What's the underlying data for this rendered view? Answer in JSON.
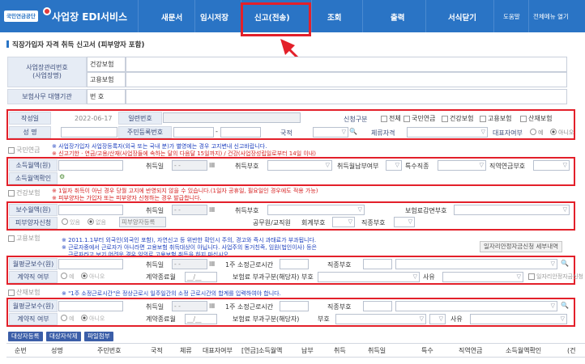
{
  "nav": {
    "logo_text": "국민연금공단",
    "app_title": "사업장 EDI서비스",
    "menu": [
      "새문서",
      "임시저장",
      "신고(전송)",
      "조회",
      "출력",
      "서식닫기"
    ],
    "help": "도움말",
    "full_menu": "전체메뉴 열기"
  },
  "page": {
    "title": "직장가입자 자격 취득 신고서 (피부양자 포함)"
  },
  "header_form": {
    "biz_no_label": "사업장관리번호\n(사업장명)",
    "health": "건강보험",
    "employment": "고용보험",
    "agency_label": "보험사무 대행기관",
    "number_label": "번 호"
  },
  "report": {
    "date_label": "작성일",
    "date_value": "2022-06-17",
    "serial_label": "일련번호",
    "report_type_label": "신청구분",
    "types": [
      "전체",
      "국민연금",
      "건강보험",
      "고용보험",
      "산재보험"
    ],
    "name_label": "성 명",
    "rrn_label": "주민등록번호",
    "nationality_label": "국적",
    "residence_label": "체류자격",
    "rep_label": "대표자여부",
    "yes": "예",
    "no": "아니오"
  },
  "pension": {
    "section": "국민연금",
    "note1": "※ 사업장가입자 사업장등록자(외국 또는 국내 분)가 별영에는 경우 고지변내 신고바랍니다.",
    "note2": "※ 신고기한 · 연금/고용/산재(사업장들에 속하는 달의 다음달 15일까지) / 건강(사업장성립일로부터 14일 이내)",
    "income_label": "소득월액(원)",
    "acq_date_label": "취득일",
    "date_placeholder": "-   -",
    "acq_code_label": "취득부호",
    "acq_month_pay_label": "취득월납부여부",
    "special_label": "특수직종",
    "occ_pension_label": "직역연금부호",
    "income_confirm_label": "소득월액확인"
  },
  "health": {
    "section": "건강보험",
    "note1": "※ 1일자 취득이 아닌 경우 당월 고지에 반영되지 않을 수 있습니다.(1일자 공휴일, 필요일인 경우에도 적용 가능)",
    "note2": "※ 피부양자는 가입자 또는 피부양자 신청하는 경우 발급합니다.",
    "pay_label": "보수월액(원)",
    "acq_date_label": "취득일",
    "acq_code_label": "취득부호",
    "reduce_label": "보험료감면부호",
    "dependent_label": "피부양자신청",
    "has": "있음",
    "none": "없음",
    "dependent_reg": "피부양자등록",
    "civil_label": "공무원/교직원",
    "account_label": "회계부호",
    "job_label": "직종부호"
  },
  "employment": {
    "section": "고용보험",
    "note1": "※ 2011.1.1부터 외국인(외국인 포함), 자연신고 등 위반한 확인시 주의, 경고와 즉시 과태료가 부과됩니다.",
    "note2": "※ 근로자중에서 근로자가 아니라면 고용보험 취득대상이 아닙니다. 사업주의 동거친족, 임원(법인이사) 등은",
    "note3": "근로자라고 보기 어려운 경우 임의로 고용보험 취득을 하지 마십시오.",
    "stability_btn": "일자리안정자금신청 세부내역",
    "wage_label": "월평균보수(원)",
    "acq_date_label": "취득일",
    "weekly_label": "1주 소정근로시간",
    "job_label": "직종부호",
    "contract_label": "계약직 여부",
    "contract_end_label": "계약종료월",
    "contract_placeholder": "__/__",
    "levy_label": "보험료 부과구분(해당자)",
    "code_label": "부호",
    "reason_label": "사유",
    "stability_chk": "일자리안정자금신청"
  },
  "industrial": {
    "section": "산재보험",
    "note": "※ \"1주 소정근로시간\"은 정상근로시 일주일간의 소정 근로시간의 합계를 입력하여야 합니다."
  },
  "actions": [
    "대상자등록",
    "대상자삭제",
    "파일첨부"
  ],
  "table_headers": [
    "순번",
    "성명",
    "주민번호",
    "국적",
    "체류",
    "대표자여부",
    "[연금]소득월액",
    "납부",
    "취득",
    "취득일",
    "특수",
    "직역연금",
    "소득월액확인",
    "(건"
  ],
  "colors": {
    "nav": "#2a74c5",
    "highlight": "#e3202a",
    "label_bg": "#e6ecf5"
  }
}
